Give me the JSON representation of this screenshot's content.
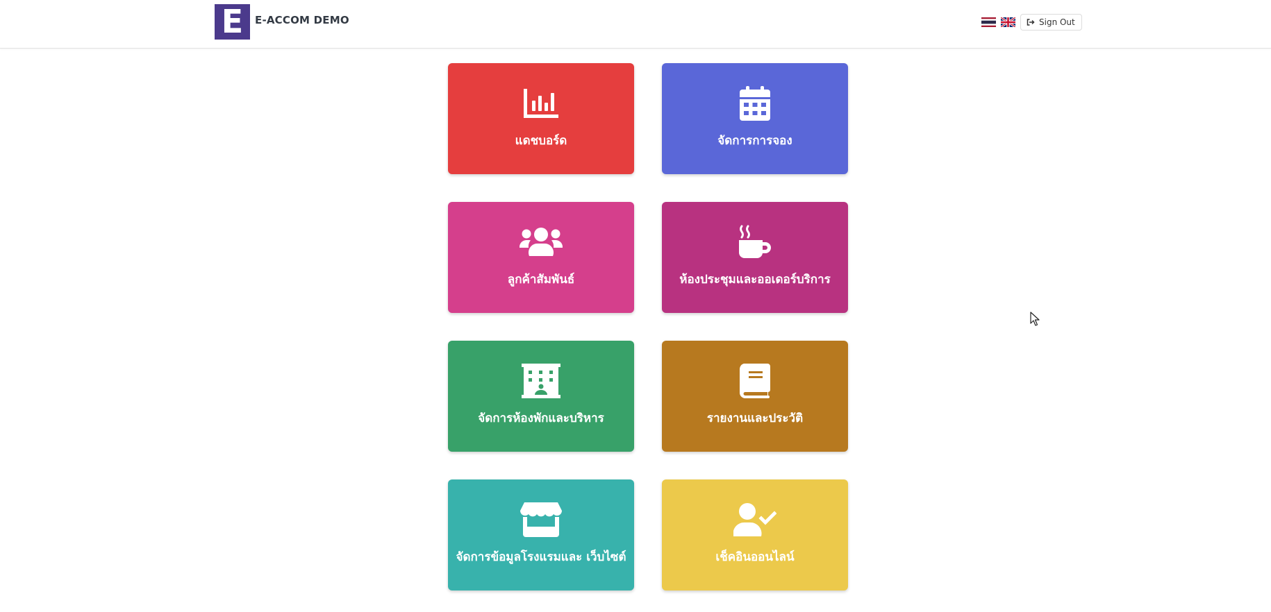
{
  "brand": {
    "logo_letter": "E",
    "name": "E-ACCOM DEMO"
  },
  "header": {
    "languages": [
      {
        "name": "thai-flag-icon"
      },
      {
        "name": "uk-flag-icon"
      }
    ],
    "signout_label": "Sign Out",
    "signout_icon": "sign-out-icon"
  },
  "tiles": [
    {
      "label": "แดชบอร์ด",
      "icon": "chart-icon",
      "color": "#e53e3e"
    },
    {
      "label": "จัดการการจอง",
      "icon": "calendar-icon",
      "color": "#5a67d8"
    },
    {
      "label": "ลูกค้าสัมพันธ์",
      "icon": "users-icon",
      "color": "#d53f8c"
    },
    {
      "label": "ห้องประชุมและออเดอร์บริการ",
      "icon": "coffee-icon",
      "color": "#b83280"
    },
    {
      "label": "จัดการห้องพักและบริหาร",
      "icon": "building-icon",
      "color": "#38a169"
    },
    {
      "label": "รายงานและประวัติ",
      "icon": "book-icon",
      "color": "#b7791f"
    },
    {
      "label": "จัดการข้อมูลโรงแรมและ เว็บไซต์",
      "icon": "store-icon",
      "color": "#38b2ac"
    },
    {
      "label": "เช็คอินออนไลน์",
      "icon": "user-check-icon",
      "color": "#ecc94b"
    }
  ]
}
